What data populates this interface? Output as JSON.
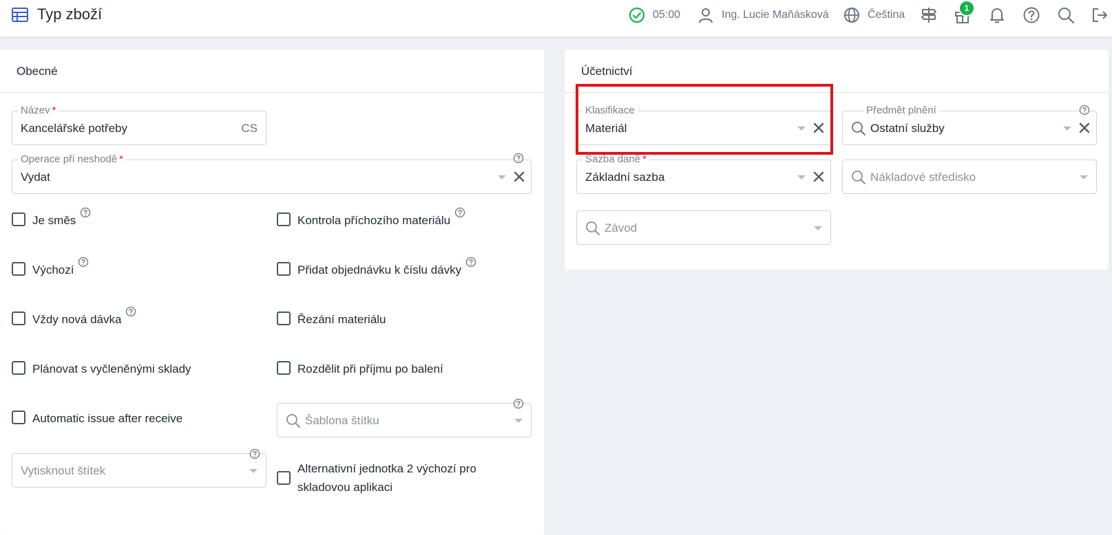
{
  "header": {
    "title": "Typ zboží",
    "time": "05:00",
    "user": "Ing. Lucie Maňásková",
    "language": "Čeština",
    "gift_badge": "1",
    "icons": [
      "table-icon",
      "check-circle-icon",
      "user-icon",
      "globe-icon",
      "signpost-icon",
      "gift-icon",
      "bell-icon",
      "help-icon",
      "search-icon",
      "logout-icon"
    ]
  },
  "general": {
    "title": "Obecné",
    "name_label": "Název",
    "name_value": "Kancelářské potřeby",
    "name_lang": "CS",
    "operation_label": "Operace při neshodě",
    "operation_value": "Vydat",
    "checkboxes_left": [
      {
        "label": "Je směs",
        "help": true,
        "checked": false
      },
      {
        "label": "Výchozí",
        "help": true,
        "checked": false
      },
      {
        "label": "Vždy nová dávka",
        "help": true,
        "checked": false
      },
      {
        "label": "Plánovat s vyčleněnými sklady",
        "help": false,
        "checked": false
      },
      {
        "label": "Automatic issue after receive",
        "help": false,
        "checked": false
      }
    ],
    "checkboxes_right": [
      {
        "label": "Kontrola příchozího materiálu",
        "help": true,
        "checked": false
      },
      {
        "label": "Přidat objednávku k číslu dávky",
        "help": true,
        "checked": false
      },
      {
        "label": "Řezání materiálu",
        "help": false,
        "checked": false
      },
      {
        "label": "Rozdělit při příjmu po balení",
        "help": false,
        "checked": false
      }
    ],
    "label_template_placeholder": "Šablona štítku",
    "print_label_placeholder": "Vytisknout štítek",
    "alt_unit_label_line1": "Alternativní jednotka 2 výchozí pro",
    "alt_unit_label_line2": "skladovou aplikaci"
  },
  "accounting": {
    "title": "Účetnictví",
    "classification_label": "Klasifikace",
    "classification_value": "Materiál",
    "subject_label": "Předmět plnění",
    "subject_value": "Ostatní služby",
    "tax_label": "Sazba daně",
    "tax_value": "Základní sazba",
    "cost_center_placeholder": "Nákladové středisko",
    "plant_placeholder": "Závod"
  },
  "colors": {
    "accent_blue": "#3b5bdb",
    "status_green": "#16b24a",
    "required_red": "#e11d2e",
    "highlight_red": "#e0141c"
  }
}
